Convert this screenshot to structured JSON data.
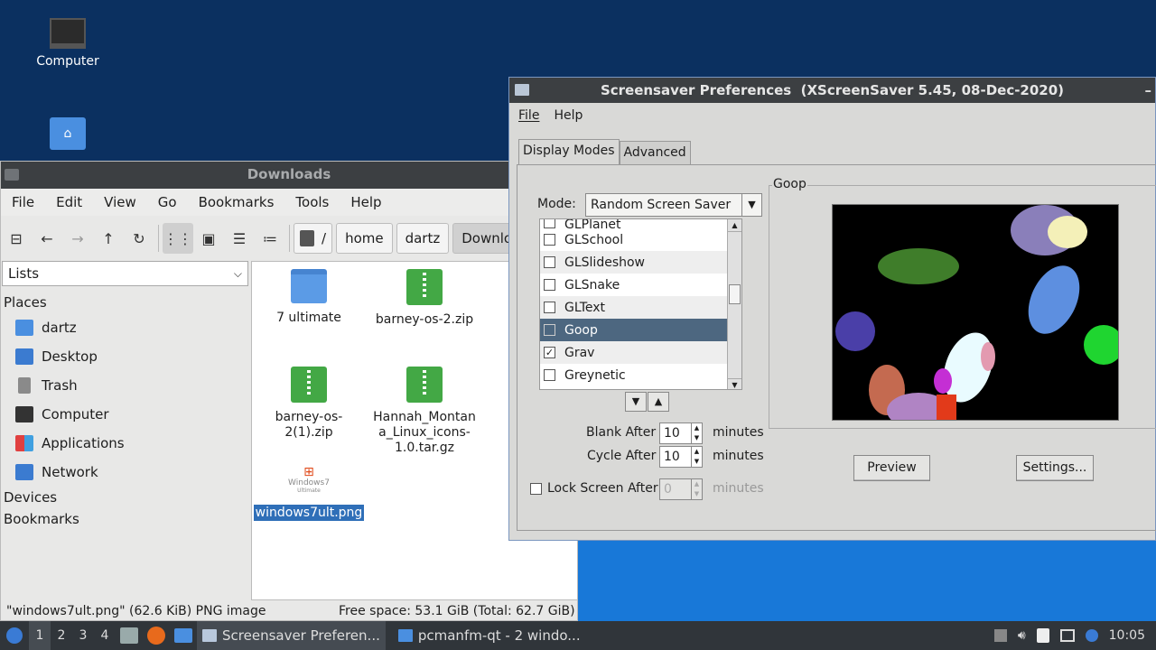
{
  "desktop": {
    "icons": [
      {
        "label": "Computer"
      }
    ]
  },
  "file_manager": {
    "title": "Downloads",
    "menu": [
      "File",
      "Edit",
      "View",
      "Go",
      "Bookmarks",
      "Tools",
      "Help"
    ],
    "breadcrumbs": [
      "/",
      "home",
      "dartz",
      "Downlo"
    ],
    "view_select": "Lists",
    "sections": {
      "places": "Places",
      "devices": "Devices",
      "bookmarks": "Bookmarks"
    },
    "places": [
      "dartz",
      "Desktop",
      "Trash",
      "Computer",
      "Applications",
      "Network"
    ],
    "files": [
      {
        "name": "7 ultimate",
        "kind": "folder"
      },
      {
        "name": "barney-os-2.zip",
        "kind": "zip"
      },
      {
        "name": "barney-os-2(1).zip",
        "kind": "zip"
      },
      {
        "name": "Hannah_Montana_Linux_icons-1.0.tar.gz",
        "kind": "zip"
      },
      {
        "name": "windows7ult.png",
        "kind": "image",
        "selected": true
      }
    ],
    "thumb_text": {
      "brand": "Windows7",
      "edition": "Ultimate"
    },
    "status_left": "\"windows7ult.png\" (62.6 KiB) PNG image",
    "status_right": "Free space: 53.1 GiB (Total: 62.7 GiB)"
  },
  "screensaver": {
    "title": "Screensaver Preferences  (XScreenSaver 5.45, 08-Dec-2020)",
    "menu": [
      "File",
      "Help"
    ],
    "tabs": [
      "Display Modes",
      "Advanced"
    ],
    "mode_label": "Mode:",
    "mode_value": "Random Screen Saver",
    "list_top_partial": "GLPlanet",
    "list": [
      {
        "name": "GLSchool",
        "checked": false
      },
      {
        "name": "GLSlideshow",
        "checked": false
      },
      {
        "name": "GLSnake",
        "checked": false
      },
      {
        "name": "GLText",
        "checked": false
      },
      {
        "name": "Goop",
        "checked": false,
        "highlighted": true
      },
      {
        "name": "Grav",
        "checked": true
      },
      {
        "name": "Greynetic",
        "checked": false
      }
    ],
    "preview_group": "Goop",
    "blank_after_label": "Blank After",
    "blank_after_value": "10",
    "cycle_after_label": "Cycle After",
    "cycle_after_value": "10",
    "lock_label": "Lock Screen After",
    "lock_value": "0",
    "unit": "minutes",
    "preview_button": "Preview",
    "settings_button": "Settings..."
  },
  "taskbar": {
    "workspaces": [
      "1",
      "2",
      "3",
      "4"
    ],
    "tasks": [
      "Screensaver Preferen...",
      "pcmanfm-qt - 2 windo..."
    ],
    "clock": "10:05"
  }
}
